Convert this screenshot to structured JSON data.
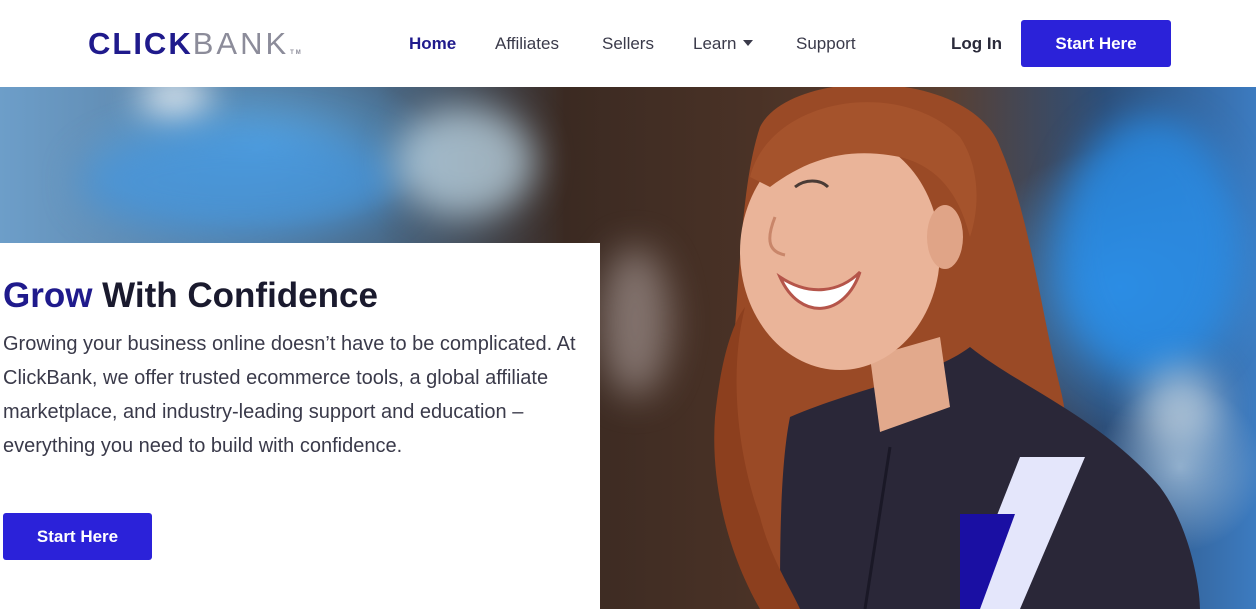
{
  "brand": {
    "part1": "CLICK",
    "part2": "BANK",
    "tm": "TM"
  },
  "nav": {
    "items": [
      {
        "label": "Home",
        "active": true
      },
      {
        "label": "Affiliates",
        "active": false
      },
      {
        "label": "Sellers",
        "active": false
      },
      {
        "label": "Learn",
        "active": false,
        "dropdown": true
      },
      {
        "label": "Support",
        "active": false
      }
    ],
    "login_label": "Log In",
    "cta_label": "Start Here"
  },
  "hero": {
    "headline_accent": "Grow",
    "headline_rest": " With Confidence",
    "description": "Growing your business online doesn’t have to be complicated. At ClickBank, we offer trusted ecommerce tools, a global affiliate marketplace, and industry-leading support and education – everything you need to build with confidence.",
    "cta_label": "Start Here"
  },
  "colors": {
    "brand_navy": "#1f1a8c",
    "primary_button": "#2b22d9",
    "accent_light": "#e4e6fb"
  },
  "icons": [
    "caret-down-icon"
  ]
}
